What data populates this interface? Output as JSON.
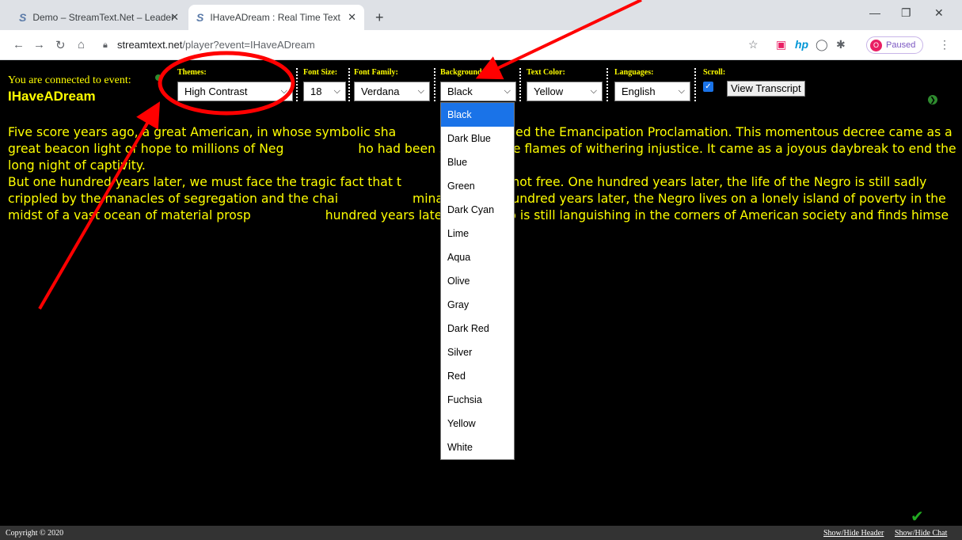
{
  "browser": {
    "tabs": [
      {
        "title": "Demo – StreamText.Net – Leader"
      },
      {
        "title": "IHaveADream : Real Time Text"
      }
    ],
    "url_host": "streamtext.net",
    "url_path": "/player?event=IHaveADream",
    "profile_label": "Paused",
    "profile_initial": "O"
  },
  "header": {
    "connected_text": "You are connected to event:",
    "event_name": "IHaveADream",
    "controls": {
      "themes": {
        "label": "Themes:",
        "value": "High Contrast"
      },
      "font_size": {
        "label": "Font Size:",
        "value": "18"
      },
      "font_family": {
        "label": "Font Family:",
        "value": "Verdana"
      },
      "background": {
        "label": "Background:",
        "value": "Black"
      },
      "text_color": {
        "label": "Text Color:",
        "value": "Yellow"
      },
      "languages": {
        "label": "Languages:",
        "value": "English"
      },
      "scroll": {
        "label": "Scroll:"
      },
      "view_transcript": "View Transcript"
    }
  },
  "transcript": {
    "p1": "Five score years ago, a great American, in whose symbolic sha",
    "p1b": "nd signed the Emancipation Proclamation. This momentous decree came as a great beacon light of hope to millions of Neg",
    "p1c": "ho had been seared in the flames of withering injustice. It came as a joyous daybreak to end the long night of captivity.",
    "p2": "But one hundred years later, we must face the tragic fact that t",
    "p2b": "s still not free. One hundred years later, the life of the Negro is still sadly crippled by the manacles of segregation and the chai",
    "p2c": "mination. One hundred years later, the Negro lives on a lonely island of poverty in the midst of a vast ocean of material prosp",
    "p2d": "hundred years later, the Negro is still languishing in the corners of American society and finds himse"
  },
  "background_options": [
    "Black",
    "Dark Blue",
    "Blue",
    "Green",
    "Dark Cyan",
    "Lime",
    "Aqua",
    "Olive",
    "Gray",
    "Dark Red",
    "Silver",
    "Red",
    "Fuchsia",
    "Yellow",
    "White"
  ],
  "footer": {
    "copyright": "Copyright © 2020",
    "show_hide_header": "Show/Hide Header",
    "show_hide_chat": "Show/Hide Chat"
  },
  "colors": {
    "text": "#ffff00",
    "page_bg": "#000000",
    "annotation": "#ff0000",
    "option_highlight": "#1a73e8"
  }
}
